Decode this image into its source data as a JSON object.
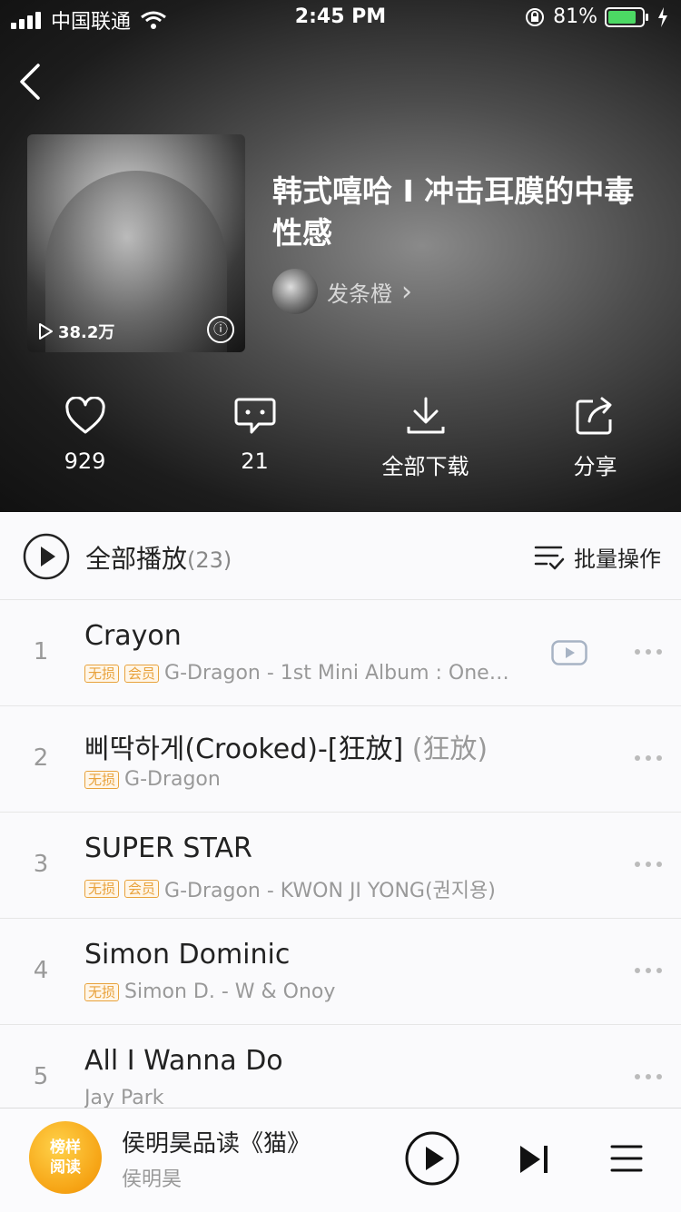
{
  "status_bar": {
    "carrier": "中国联通",
    "time": "2:45 PM",
    "battery": "81%"
  },
  "playlist": {
    "title": "韩式嘻哈 I 冲击耳膜的中毒性感",
    "play_count": "38.2万",
    "creator": "发条橙",
    "creator_arrow": "›"
  },
  "actions": [
    {
      "icon": "heart-icon",
      "label": "929"
    },
    {
      "icon": "comment-icon",
      "label": "21"
    },
    {
      "icon": "download-icon",
      "label": "全部下载"
    },
    {
      "icon": "share-icon",
      "label": "分享"
    }
  ],
  "play_all": {
    "label": "全部播放",
    "count": "(23)",
    "batch_label": "批量操作"
  },
  "songs": [
    {
      "num": "1",
      "name": "Crayon",
      "alias": "",
      "tags": [
        "无损",
        "会员"
      ],
      "sub": "G-Dragon - 1st Mini Album : One…",
      "has_mv": true
    },
    {
      "num": "2",
      "name": "삐딱하게(Crooked)-[狂放]",
      "alias": " (狂放)",
      "tags": [
        "无损"
      ],
      "sub": "G-Dragon",
      "has_mv": false
    },
    {
      "num": "3",
      "name": "SUPER STAR",
      "alias": "",
      "tags": [
        "无损",
        "会员"
      ],
      "sub": "G-Dragon - KWON JI YONG(권지용)",
      "has_mv": false
    },
    {
      "num": "4",
      "name": "Simon Dominic",
      "alias": "",
      "tags": [
        "无损"
      ],
      "sub": "Simon D. - W & Onoy",
      "has_mv": false
    },
    {
      "num": "5",
      "name": "All I Wanna Do",
      "alias": "",
      "tags": [],
      "sub": "Jay Park",
      "has_mv": false
    }
  ],
  "mini_player": {
    "cover_text_1": "榜样",
    "cover_text_2": "阅读",
    "title": "侯明昊品读《猫》",
    "artist": "侯明昊"
  },
  "colors": {
    "tag_accent": "#e8a23c",
    "hero_dark": "#111111",
    "mv_icon": "#a7b3c4"
  }
}
